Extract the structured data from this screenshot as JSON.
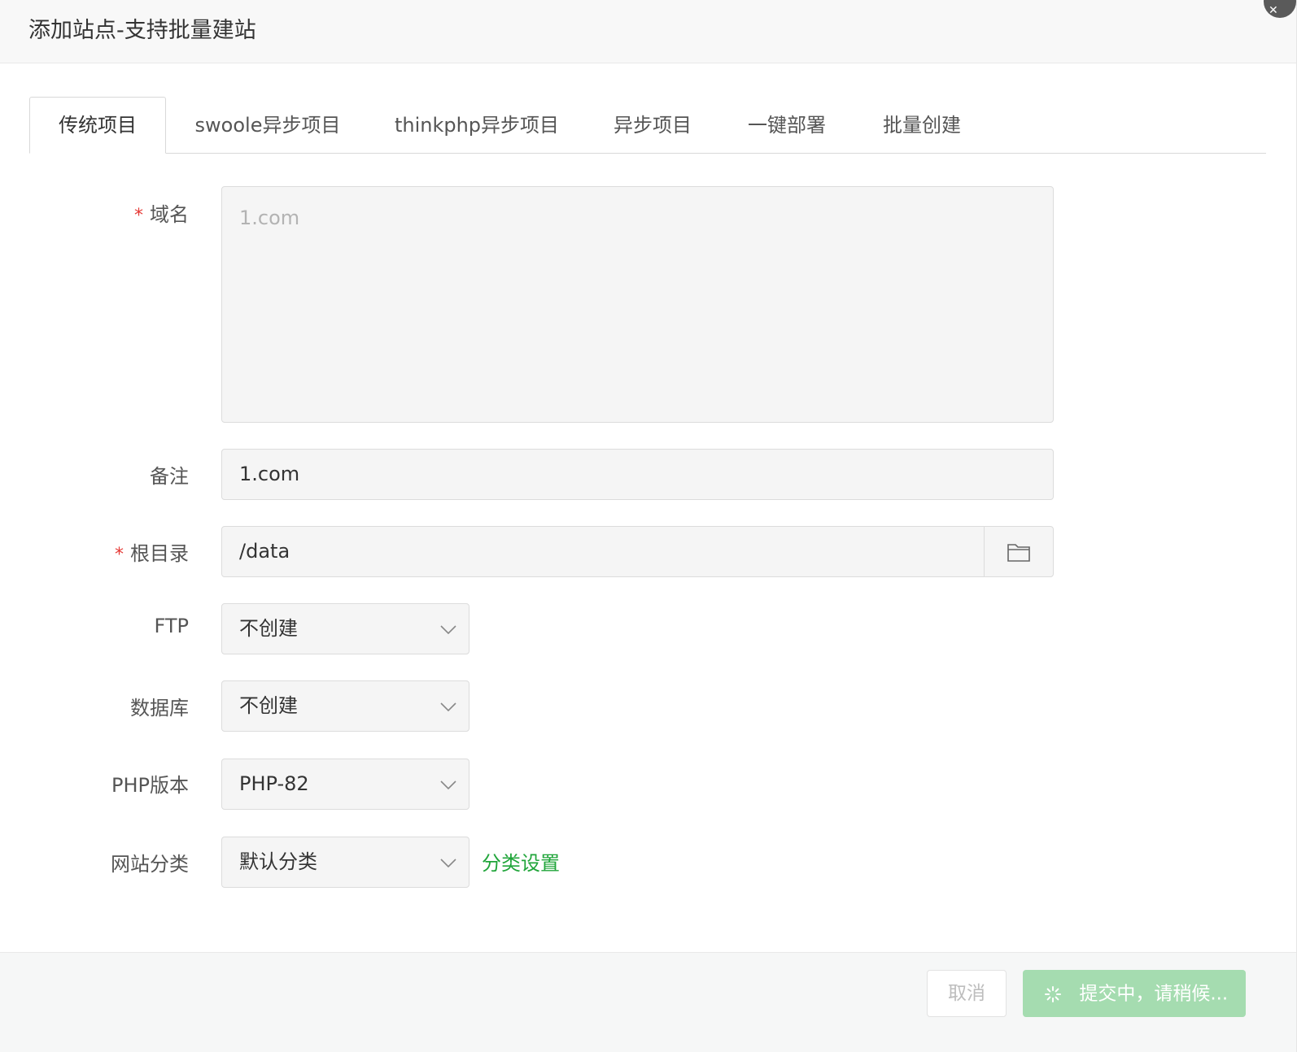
{
  "dialog": {
    "title": "添加站点-支持批量建站"
  },
  "tabs": [
    {
      "label": "传统项目",
      "active": true
    },
    {
      "label": "swoole异步项目"
    },
    {
      "label": "thinkphp异步项目"
    },
    {
      "label": "异步项目"
    },
    {
      "label": "一键部署"
    },
    {
      "label": "批量创建"
    }
  ],
  "form": {
    "domain": {
      "required_mark": "*",
      "label": "域名",
      "placeholder": "1.com"
    },
    "remark": {
      "label": "备注",
      "value": "1.com"
    },
    "rootdir": {
      "required_mark": "*",
      "label": "根目录",
      "value": "/data",
      "icon": "folder-icon"
    },
    "ftp": {
      "label": "FTP",
      "value": "不创建"
    },
    "database": {
      "label": "数据库",
      "value": "不创建"
    },
    "php": {
      "label": "PHP版本",
      "value": "PHP-82"
    },
    "category": {
      "label": "网站分类",
      "value": "默认分类",
      "link": "分类设置"
    }
  },
  "footer": {
    "cancel_label": "取消",
    "submit_label": "提交中，请稍候..."
  },
  "colors": {
    "accent": "#20a53a",
    "submit_disabled": "#a5dcb0",
    "required": "#e53935"
  }
}
